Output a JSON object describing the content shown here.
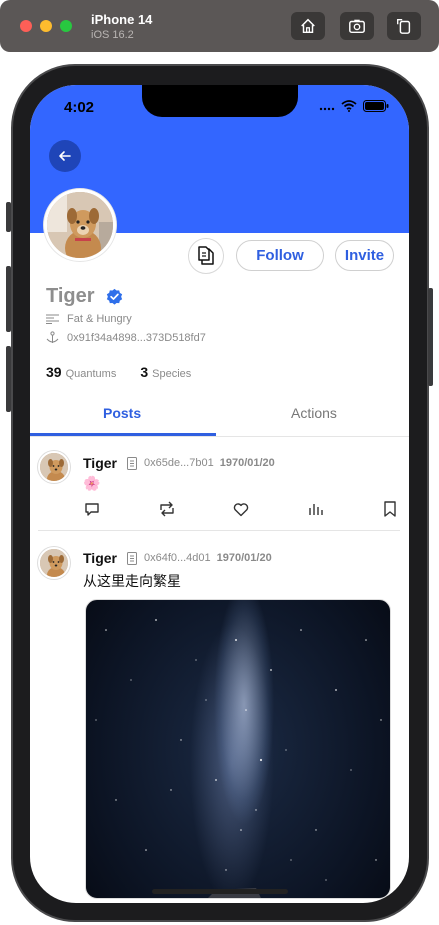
{
  "simulator": {
    "device_name": "iPhone 14",
    "os_version": "iOS 16.2",
    "buttons": [
      "home-icon",
      "screenshot-icon",
      "rotate-icon"
    ]
  },
  "status_bar": {
    "time": "4:02"
  },
  "profile": {
    "name": "Tiger",
    "verified": true,
    "bio": "Fat & Hungry",
    "address": "0x91f34a4898...373D518fd7",
    "buttons": {
      "follow": "Follow",
      "invite": "Invite"
    },
    "stats": [
      {
        "value": "39",
        "label": "Quantums"
      },
      {
        "value": "3",
        "label": "Species"
      }
    ]
  },
  "tabs": {
    "active": "Posts",
    "inactive": "Actions"
  },
  "posts": [
    {
      "author": "Tiger",
      "address": "0x65de...7b01",
      "date": "1970/01/20",
      "body": "🌸"
    },
    {
      "author": "Tiger",
      "address": "0x64f0...4d01",
      "date": "1970/01/20",
      "body": "从这里走向繁星"
    }
  ],
  "colors": {
    "accent": "#3366ff",
    "link": "#2f5fe0"
  }
}
